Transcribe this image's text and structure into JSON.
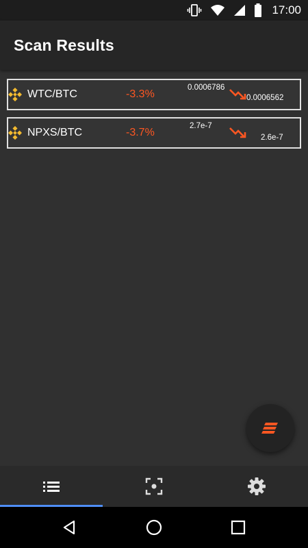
{
  "status_bar": {
    "time": "17:00",
    "icons": [
      "vibrate-icon",
      "wifi-icon",
      "signal-icon",
      "battery-icon"
    ]
  },
  "app_bar": {
    "title": "Scan Results"
  },
  "results": [
    {
      "exchange_icon": "binance-icon",
      "pair": "WTC/BTC",
      "change": "-3.3%",
      "price_old": "0.0006786",
      "price_new": "0.0006562",
      "trend_icon": "trending-down-icon"
    },
    {
      "exchange_icon": "binance-icon",
      "pair": "NPXS/BTC",
      "change": "-3.7%",
      "price_old": "2.7e-7",
      "price_new": "2.6e-7",
      "trend_icon": "trending-down-icon"
    }
  ],
  "fab": {
    "icon": "stack-icon"
  },
  "bottom_nav": {
    "tabs": [
      {
        "icon": "list-icon",
        "active": true
      },
      {
        "icon": "scan-icon",
        "active": false
      },
      {
        "icon": "settings-icon",
        "active": false
      }
    ]
  },
  "system_nav": [
    "back-icon",
    "home-icon",
    "recents-icon"
  ],
  "colors": {
    "background": "#303030",
    "app_bar": "#262626",
    "accent_negative": "#ff5722",
    "active_tab_indicator": "#4f8ef7",
    "binance_yellow": "#f3ba2f"
  }
}
